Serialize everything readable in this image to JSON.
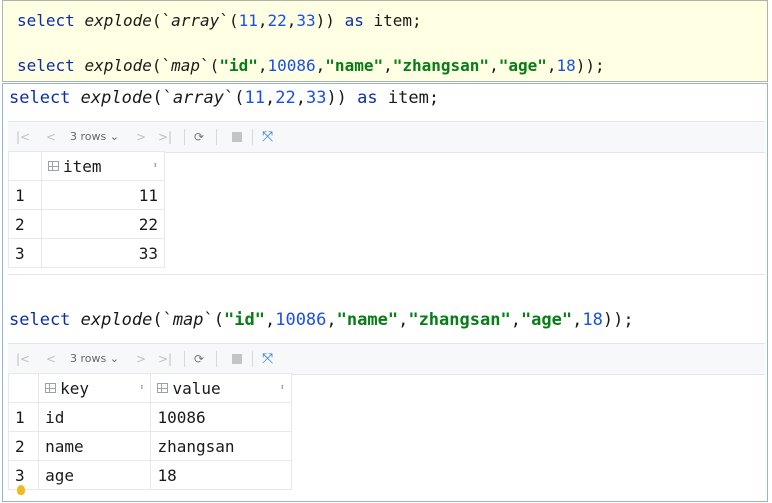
{
  "editor": {
    "line1": {
      "select": "select",
      "explode": "explode",
      "open": "(`",
      "fnname": "array",
      "close": "`(",
      "n1": "11",
      "c1": ",",
      "n2": "22",
      "c2": ",",
      "n3": "33",
      "end": "))",
      "as": "as",
      "alias": "item;"
    },
    "line2": {
      "select": "select",
      "explode": "explode",
      "open": "(`",
      "fnname": "map",
      "close": "`(",
      "s1": "\"id\"",
      "c1": ",",
      "n1": "10086",
      "c2": ",",
      "s2": "\"name\"",
      "c3": ",",
      "s3": "\"zhangsan\"",
      "c4": ",",
      "s4": "\"age\"",
      "c5": ",",
      "n2": "18",
      "end": "));"
    }
  },
  "console": {
    "query1": {
      "select": "select",
      "explode": "explode",
      "open": "(`",
      "fnname": "array",
      "close": "`(",
      "n1": "11",
      "c1": ",",
      "n2": "22",
      "c2": ",",
      "n3": "33",
      "end": "))",
      "as": "as",
      "alias": "item;"
    },
    "query2": {
      "select": "select",
      "explode": "explode",
      "open": "(`",
      "fnname": "map",
      "close": "`(",
      "s1": "\"id\"",
      "c1": ",",
      "n1": "10086",
      "c2": ",",
      "s2": "\"name\"",
      "c3": ",",
      "s3": "\"zhangsan\"",
      "c4": ",",
      "s4": "\"age\"",
      "c5": ",",
      "n2": "18",
      "end": "));"
    },
    "toolbar": {
      "first": "|<",
      "prev": "<",
      "rows": "3 rows ⌄",
      "next": ">",
      "last": ">|",
      "refresh": "⟳",
      "pin": "⤧"
    },
    "result1": {
      "columns": [
        "item"
      ],
      "rows": [
        {
          "n": "1",
          "item": "11"
        },
        {
          "n": "2",
          "item": "22"
        },
        {
          "n": "3",
          "item": "33"
        }
      ]
    },
    "result2": {
      "columns": [
        "key",
        "value"
      ],
      "rows": [
        {
          "n": "1",
          "key": "id",
          "value": "10086"
        },
        {
          "n": "2",
          "key": "name",
          "value": "zhangsan"
        },
        {
          "n": "3",
          "key": "age",
          "value": "18"
        }
      ]
    }
  },
  "colors": {
    "keyword": "#0b2ea8",
    "number": "#1750eb",
    "string": "#067d17",
    "editor_bg": "#ffffe4",
    "console_border": "#8fb4e6"
  }
}
